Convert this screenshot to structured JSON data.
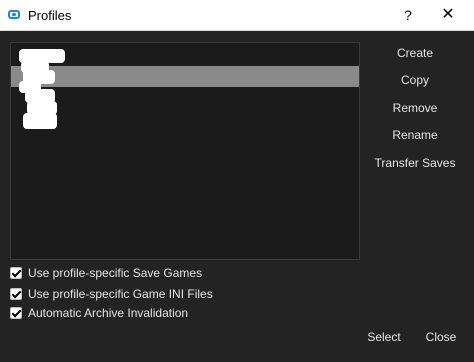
{
  "window": {
    "title": "Profiles",
    "help_label": "?",
    "close_label": "✕"
  },
  "profiles": {
    "items": [
      {
        "label": ""
      },
      {
        "label": ""
      },
      {
        "label": ""
      }
    ]
  },
  "actions": {
    "create": "Create",
    "copy": "Copy",
    "remove": "Remove",
    "rename": "Rename",
    "transfer_saves": "Transfer Saves"
  },
  "options": {
    "save_games": {
      "label": "Use profile-specific Save Games",
      "checked": true
    },
    "game_ini": {
      "label": "Use profile-specific Game INI Files",
      "checked": true
    },
    "archive_invalidation": {
      "label": "Automatic Archive Invalidation",
      "checked": true
    }
  },
  "footer": {
    "select": "Select",
    "close": "Close"
  }
}
